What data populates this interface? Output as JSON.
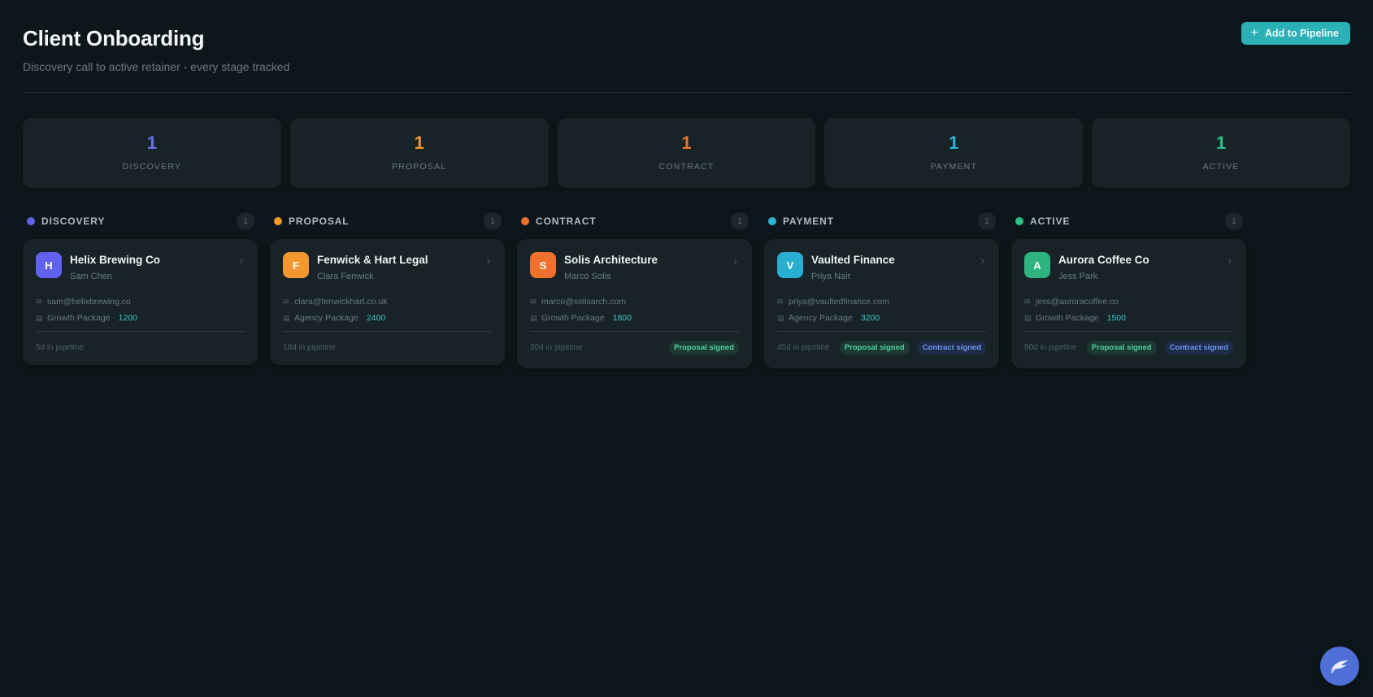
{
  "header": {
    "title": "Client Onboarding",
    "subtitle": "Discovery call to active retainer - every stage tracked",
    "add_button_label": "Add to Pipeline"
  },
  "stats": [
    {
      "count": "1",
      "label": "DISCOVERY",
      "color": "#6b6ff0"
    },
    {
      "count": "1",
      "label": "PROPOSAL",
      "color": "#f2982f"
    },
    {
      "count": "1",
      "label": "CONTRACT",
      "color": "#f0702e"
    },
    {
      "count": "1",
      "label": "PAYMENT",
      "color": "#2eb3d6"
    },
    {
      "count": "1",
      "label": "ACTIVE",
      "color": "#2fbf86"
    }
  ],
  "columns": [
    {
      "name": "DISCOVERY",
      "count": "1",
      "color": "#6163ee",
      "card": {
        "initial": "H",
        "avatar_color": "#6061ee",
        "company": "Helix Brewing Co",
        "contact": "Sam Chen",
        "email": "sam@helixbrewing.co",
        "package": "Growth Package",
        "amount": "1200",
        "age": "5d in pipeline",
        "badges": []
      }
    },
    {
      "name": "PROPOSAL",
      "count": "1",
      "color": "#f2982f",
      "card": {
        "initial": "F",
        "avatar_color": "#f2982f",
        "company": "Fenwick & Hart Legal",
        "contact": "Clara Fenwick",
        "email": "clara@fenwickhart.co.uk",
        "package": "Agency Package",
        "amount": "2400",
        "age": "18d in pipeline",
        "badges": []
      }
    },
    {
      "name": "CONTRACT",
      "count": "1",
      "color": "#f0702e",
      "card": {
        "initial": "S",
        "avatar_color": "#f0702e",
        "company": "Solis Architecture",
        "contact": "Marco Solis",
        "email": "marco@solisarch.com",
        "package": "Growth Package",
        "amount": "1800",
        "age": "30d in pipeline",
        "badges": [
          "Proposal signed"
        ]
      }
    },
    {
      "name": "PAYMENT",
      "count": "1",
      "color": "#2eb3d6",
      "card": {
        "initial": "V",
        "avatar_color": "#27aed0",
        "company": "Vaulted Finance",
        "contact": "Priya Nair",
        "email": "priya@vaultedfinance.com",
        "package": "Agency Package",
        "amount": "3200",
        "age": "45d in pipeline",
        "badges": [
          "Proposal signed",
          "Contract signed"
        ]
      }
    },
    {
      "name": "ACTIVE",
      "count": "1",
      "color": "#2fbf86",
      "card": {
        "initial": "A",
        "avatar_color": "#2fb37f",
        "company": "Aurora Coffee Co",
        "contact": "Jess Park",
        "email": "jess@auroracoffee.co",
        "package": "Growth Package",
        "amount": "1500",
        "age": "90d in pipeline",
        "badges": [
          "Proposal signed",
          "Contract signed"
        ]
      }
    }
  ],
  "icons": {
    "add": "plus-icon",
    "email": "mail-icon",
    "package": "package-icon",
    "open": "chevron-right-icon",
    "assistant": "assistant-icon"
  }
}
